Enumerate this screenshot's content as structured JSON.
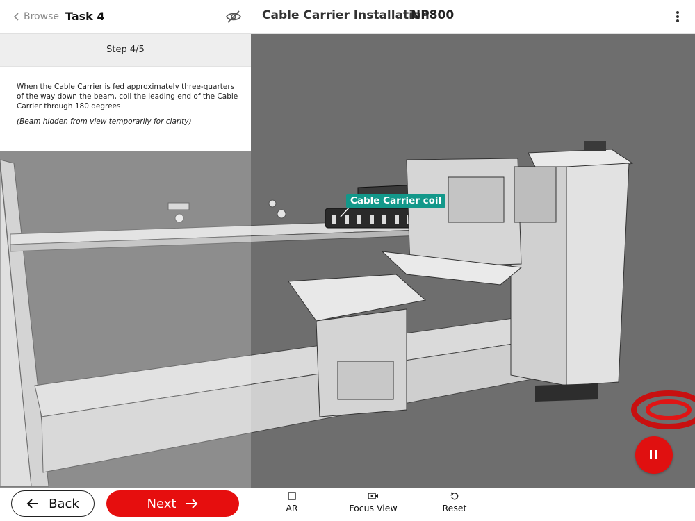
{
  "header": {
    "back_label": "Browse",
    "task_title": "Task 4",
    "title": "Cable Carrier Installation",
    "model_code": "NP800"
  },
  "step": {
    "label": "Step 4/5",
    "instruction": "When the Cable Carrier is fed approximately three-quarters of the way down the beam, coil the leading end of the Cable Carrier through 180 degrees",
    "note": "(Beam hidden from view temporarily for clarity)"
  },
  "scene": {
    "callout_label": "Cable Carrier coil"
  },
  "footer": {
    "back_label": "Back",
    "next_label": "Next",
    "tools": [
      "AR",
      "Focus View",
      "Reset"
    ]
  },
  "colors": {
    "accent_red": "#e60e0e",
    "callout_teal": "#13988a"
  },
  "icons": [
    "chevron-left-icon",
    "eye-off-icon",
    "more-vertical-icon",
    "pause-icon",
    "arrow-left-icon",
    "arrow-right-icon",
    "ar-square-icon",
    "camera-icon",
    "reset-icon"
  ]
}
